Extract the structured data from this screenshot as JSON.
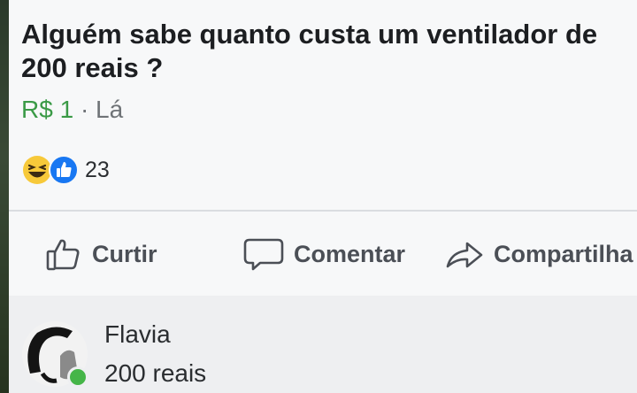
{
  "post": {
    "question": "Alguém sabe quanto custa um ventilador de 200 reais ?",
    "price": "R$ 1",
    "separator": "·",
    "location": "Lá",
    "reaction_count": "23"
  },
  "actions": {
    "like_label": "Curtir",
    "comment_label": "Comentar",
    "share_label": "Compartilha"
  },
  "comment": {
    "author": "Flavia",
    "text": "200 reais"
  },
  "colors": {
    "price_green": "#3a9a46",
    "like_blue": "#1877f2",
    "haha_yellow": "#f7c93a",
    "online_green": "#45b548"
  },
  "icons": [
    "haha-emoji-icon",
    "like-reaction-icon",
    "thumbs-up-icon",
    "comment-bubble-icon",
    "share-arrow-icon"
  ]
}
